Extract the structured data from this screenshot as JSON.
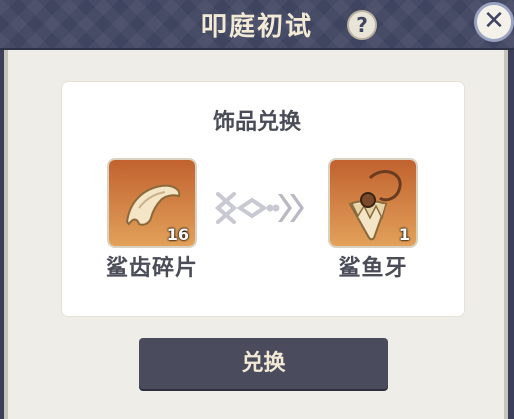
{
  "header": {
    "title": "叩庭初试",
    "help_label": "?"
  },
  "exchange": {
    "heading": "饰品兑换",
    "source": {
      "name": "鲨齿碎片",
      "count": "16",
      "icon": "shark-tooth-fragment-icon"
    },
    "target": {
      "name": "鲨鱼牙",
      "count": "1",
      "icon": "shark-tooth-necklace-icon"
    }
  },
  "actions": {
    "exchange_label": "兑换"
  },
  "colors": {
    "accent": "#3f4460",
    "item_bg_top": "#c1622f",
    "item_bg_bottom": "#e2a15a"
  }
}
